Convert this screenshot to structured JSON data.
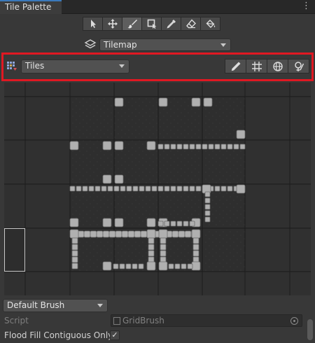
{
  "window": {
    "tab_title": "Tile Palette",
    "menu_icon": "kebab-menu-icon"
  },
  "toolbar": {
    "tools": [
      {
        "name": "select-tool",
        "icon": "arrow-pointer-icon"
      },
      {
        "name": "move-tool",
        "icon": "move-arrows-icon"
      },
      {
        "name": "paint-tool",
        "icon": "paintbrush-icon",
        "active": true
      },
      {
        "name": "box-fill-tool",
        "icon": "box-fill-icon"
      },
      {
        "name": "picker-tool",
        "icon": "eyedropper-icon"
      },
      {
        "name": "erase-tool",
        "icon": "eraser-icon"
      },
      {
        "name": "fill-tool",
        "icon": "paint-bucket-icon"
      }
    ]
  },
  "active_tilemap": {
    "label": "Tilemap"
  },
  "palette": {
    "selected": "Tiles",
    "tools": [
      {
        "name": "edit-palette-button",
        "icon": "pencil-icon"
      },
      {
        "name": "toggle-grid-button",
        "icon": "grid-icon"
      },
      {
        "name": "gizmos-button",
        "icon": "gizmo-sphere-icon"
      },
      {
        "name": "focus-button",
        "icon": "focus-icon"
      }
    ]
  },
  "brush": {
    "selected": "Default Brush"
  },
  "script": {
    "label": "Script",
    "value": "GridBrush"
  },
  "flood_fill": {
    "label": "Flood Fill Contiguous Only",
    "checked": true,
    "check_glyph": "✓"
  },
  "colors": {
    "accent_tab": "#3a79bb",
    "highlight_box": "#e01822",
    "tile_fill": "#b0b0b0",
    "tile_background": "#2e2e2e"
  }
}
